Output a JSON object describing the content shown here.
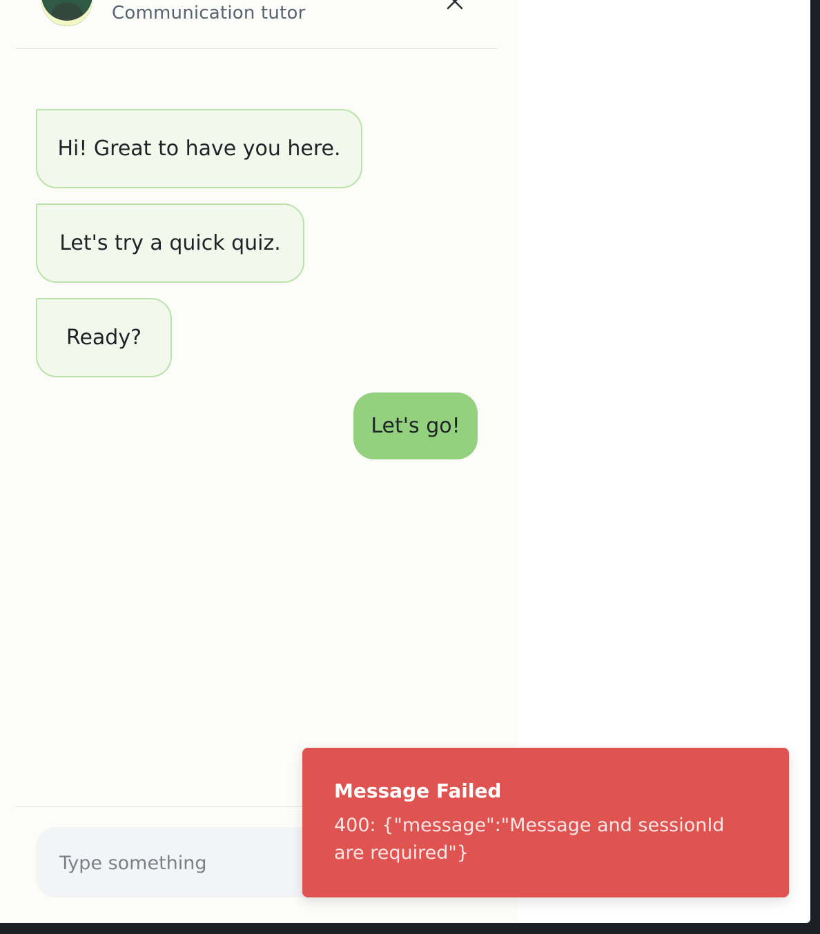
{
  "header": {
    "subtitle": "Communication tutor",
    "avatar_icon": "tutor-avatar",
    "close_icon": "close-icon"
  },
  "messages": [
    {
      "from": "bot",
      "text": "Hi! Great to have you here."
    },
    {
      "from": "bot",
      "text": "Let's try a quick quiz."
    },
    {
      "from": "bot",
      "text": "Ready?"
    },
    {
      "from": "user",
      "text": "Let's go!"
    }
  ],
  "composer": {
    "placeholder": "Type something",
    "value": ""
  },
  "toast": {
    "title": "Message Failed",
    "body": "400: {\"message\":\"Message and sessionId are required\"}"
  },
  "colors": {
    "bot_bubble_bg": "#f2f8ec",
    "bot_bubble_border": "#b9e3a8",
    "user_bubble_bg": "#93d17e",
    "toast_bg": "#df5350",
    "chat_bg": "#fcfdf8"
  }
}
